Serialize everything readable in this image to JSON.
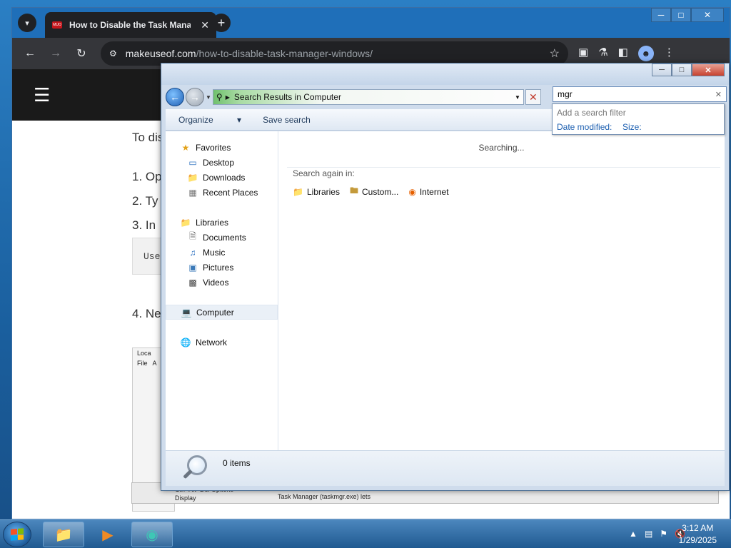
{
  "browser": {
    "tab_title": "How to Disable the Task Manager",
    "tab_favicon_text": "MUO",
    "url_host": "makeuseof.com",
    "url_path": "/how-to-disable-task-manager-windows/"
  },
  "article": {
    "intro": "To disab",
    "step1": "1. Op",
    "step2": "2. Ty",
    "step3": "3. In",
    "code_prefix": "Use",
    "step4": "4. Ne",
    "shot_title": "Loca",
    "shot_menu_file": "File",
    "shot_menu_a": "A",
    "bottom_line1": "Ctrl+Alt+Del Options",
    "bottom_line2": "Display",
    "bottom_line3": "Task Manager (taskmgr.exe) lets"
  },
  "explorer": {
    "address": "Search Results in Computer",
    "search_value": "mgr",
    "toolbar": {
      "organize": "Organize",
      "save_search": "Save search"
    },
    "nav": {
      "favorites": "Favorites",
      "desktop": "Desktop",
      "downloads": "Downloads",
      "recent": "Recent Places",
      "libraries": "Libraries",
      "documents": "Documents",
      "music": "Music",
      "pictures": "Pictures",
      "videos": "Videos",
      "computer": "Computer",
      "network": "Network"
    },
    "searching": "Searching...",
    "search_again": "Search again in:",
    "search_locations": {
      "libraries": "Libraries",
      "custom": "Custom...",
      "internet": "Internet"
    },
    "item_count": "0 items",
    "filter": {
      "hint": "Add a search filter",
      "date_modified": "Date modified:",
      "size": "Size:"
    }
  },
  "taskbar": {
    "time": "3:12 AM",
    "date": "1/29/2025"
  }
}
